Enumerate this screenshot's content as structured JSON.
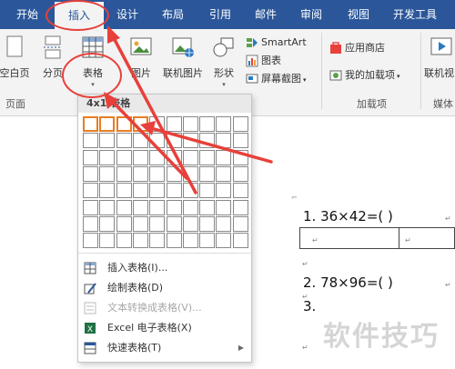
{
  "tabs": [
    {
      "label": "开始",
      "active": false
    },
    {
      "label": "插入",
      "active": true
    },
    {
      "label": "设计",
      "active": false
    },
    {
      "label": "布局",
      "active": false
    },
    {
      "label": "引用",
      "active": false
    },
    {
      "label": "邮件",
      "active": false
    },
    {
      "label": "审阅",
      "active": false
    },
    {
      "label": "视图",
      "active": false
    },
    {
      "label": "开发工具",
      "active": false
    }
  ],
  "ribbon": {
    "blank_page": "空白页",
    "page_break": "分页",
    "table": "表格",
    "picture": "图片",
    "online_picture": "联机图片",
    "shapes": "形状",
    "smartart": "SmartArt",
    "chart": "图表",
    "screenshot": "屏幕截图",
    "app_store": "应用商店",
    "my_addins": "我的加载项",
    "online_video": "联机视",
    "groups": {
      "pages": "页面",
      "addins": "加载项",
      "media": "媒体"
    }
  },
  "dropdown": {
    "title": "4x1 表格",
    "grid": {
      "cols": 10,
      "rows": 8,
      "selected_cols": 4,
      "selected_rows": 1
    },
    "items": [
      {
        "label": "插入表格(I)...",
        "disabled": false,
        "icon": "insert-table-icon"
      },
      {
        "label": "绘制表格(D)",
        "disabled": false,
        "icon": "draw-table-icon"
      },
      {
        "label": "文本转换成表格(V)...",
        "disabled": true,
        "icon": "text-to-table-icon"
      },
      {
        "label": "Excel 电子表格(X)",
        "disabled": false,
        "icon": "excel-icon"
      },
      {
        "label": "快速表格(T)",
        "disabled": false,
        "icon": "quick-table-icon"
      }
    ]
  },
  "document": {
    "q1": "1.   36×42=(           )",
    "q2": "2.   78×96=(           )",
    "q3": "3.",
    "watermark": "软件技巧"
  },
  "colors": {
    "tab_bar": "#2b579a",
    "ribbon": "#f3f3f3",
    "highlight": "#e67e22",
    "annotation": "#e8403a"
  }
}
